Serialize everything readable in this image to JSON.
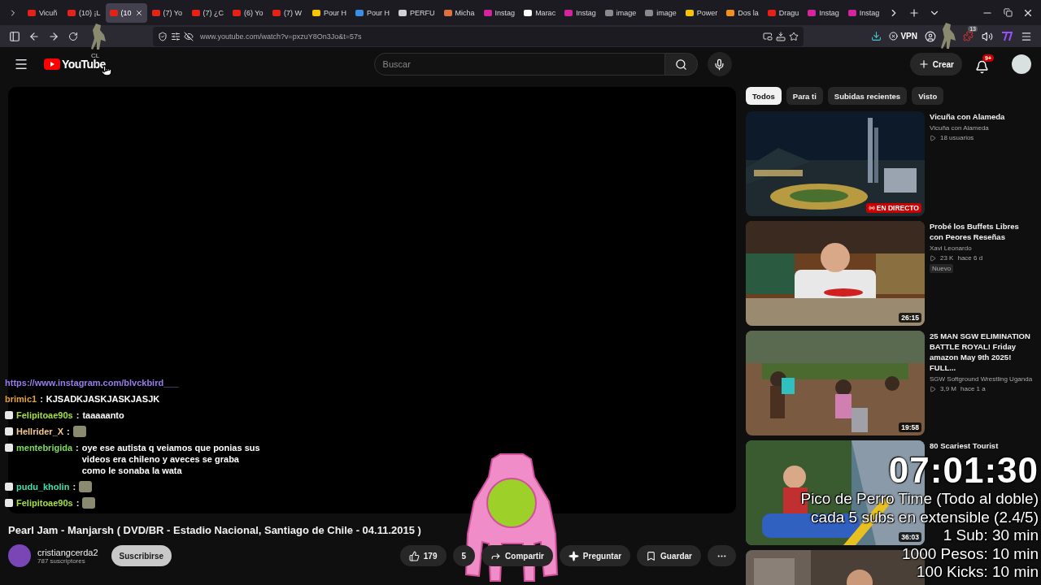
{
  "browser": {
    "tabs": [
      {
        "label": "Vicuñ",
        "color": "#e62117",
        "selected": false
      },
      {
        "label": "(10) ¡L",
        "color": "#e62117",
        "selected": false
      },
      {
        "label": "(10",
        "color": "#e62117",
        "selected": true
      },
      {
        "label": "(7) Yo",
        "color": "#e62117",
        "selected": false
      },
      {
        "label": "(7) ¿C",
        "color": "#e62117",
        "selected": false
      },
      {
        "label": "(6) Yo",
        "color": "#e62117",
        "selected": false
      },
      {
        "label": "(7) W",
        "color": "#e62117",
        "selected": false
      },
      {
        "label": "Pour H",
        "color": "#f5c400",
        "selected": false
      },
      {
        "label": "Pour H",
        "color": "#3b8ee8",
        "selected": false
      },
      {
        "label": "PERFU",
        "color": "#d0d0d0",
        "selected": false
      },
      {
        "label": "Micha",
        "color": "#e07040",
        "selected": false
      },
      {
        "label": "Instag",
        "color": "#d6249f",
        "selected": false
      },
      {
        "label": "Marac",
        "color": "#ffffff",
        "selected": false
      },
      {
        "label": "Instag",
        "color": "#d6249f",
        "selected": false
      },
      {
        "label": "image",
        "color": "#8a8a8a",
        "selected": false
      },
      {
        "label": "image",
        "color": "#8a8a8a",
        "selected": false
      },
      {
        "label": "Power",
        "color": "#f5c400",
        "selected": false
      },
      {
        "label": "Dos la",
        "color": "#f09020",
        "selected": false
      },
      {
        "label": "Dragu",
        "color": "#e62117",
        "selected": false
      },
      {
        "label": "Instag",
        "color": "#d6249f",
        "selected": false
      },
      {
        "label": "Instag",
        "color": "#d6249f",
        "selected": false
      }
    ],
    "url": "www.youtube.com/watch?v=pxzuY8On3Jo&t=57s",
    "vpn": "VPN",
    "extension_badge": "13",
    "sticker_label": "CL"
  },
  "header": {
    "logo": "YouTube",
    "search": {
      "placeholder": "Buscar"
    },
    "create": "Crear",
    "notifications": "9+"
  },
  "video": {
    "title": "Pearl Jam - Manjarsh ( DVD/BR - Estadio Nacional, Santiago de Chile - 04.11.2015 )",
    "channel": {
      "name": "cristiangcerda2",
      "subscribers": "787 suscriptores",
      "subscribe": "Suscribirse"
    },
    "likes": "179",
    "dislikes": "5",
    "actions": [
      {
        "kind": "share",
        "label": "Compartir"
      },
      {
        "kind": "ask",
        "label": "Preguntar"
      },
      {
        "kind": "save",
        "label": "Guardar"
      }
    ]
  },
  "chat": [
    {
      "kind": "link",
      "text": "https://www.instagram.com/blvckbird___"
    },
    {
      "kind": "text",
      "user": "brimic1",
      "sep": ":",
      "color": "#e8a23c",
      "badge": false,
      "text": "KJSADKJASKJASKJASJK"
    },
    {
      "kind": "text",
      "user": "Felipitoae90s",
      "sep": ":",
      "color": "#a6e23a",
      "badge": true,
      "text": "taaaaanto"
    },
    {
      "kind": "emote",
      "user": "Hellrider_X",
      "sep": ":",
      "color": "#f2c98a",
      "badge": true
    },
    {
      "kind": "text",
      "user": "mentebrigida",
      "sep": ":",
      "color": "#7ede5a",
      "badge": true,
      "text": "oye ese autista q veiamos que ponias sus videos era chileno y aveces se graba como le sonaba la wata"
    },
    {
      "kind": "emote",
      "user": "pudu_kholin",
      "sep": ":",
      "color": "#3ee0b0",
      "badge": true
    },
    {
      "kind": "emote",
      "user": "Felipitoae90s",
      "sep": ":",
      "color": "#a6e23a",
      "badge": true
    }
  ],
  "sidebar": {
    "chips": [
      {
        "label": "Todos",
        "selected": true
      },
      {
        "label": "Para ti",
        "selected": false
      },
      {
        "label": "Subidas recientes",
        "selected": false
      },
      {
        "label": "Visto",
        "selected": false
      }
    ],
    "videos": [
      {
        "title": "Vicuña con Alameda",
        "channel": "Vicuña con Alameda",
        "views": "18 usuarios",
        "live": "EN DIRECTO"
      },
      {
        "title": "Probé los Buffets Libres con Peores Reseñas",
        "channel": "Xavi Leonardo",
        "views": "23 K",
        "age": "hace 6 d",
        "badge": "Nuevo",
        "duration": "26:15"
      },
      {
        "title": "25 MAN SGW ELIMINATION BATTLE ROYAL! Friday amazon May 9th 2025! FULL...",
        "channel": "SGW Softground Wrestling Uganda",
        "views": "3,9 M",
        "age": "hace 1 a",
        "duration": "19:58"
      },
      {
        "title": "80 Scariest Tourist",
        "duration": "36:03"
      },
      {
        "kind": "picture"
      }
    ]
  },
  "timer": {
    "time": "07:01:30",
    "lines": [
      "Pico de Perro Time (Todo al doble)",
      "cada 5 subs en extensible (2.4/5)",
      "1 Sub: 30 min",
      "1000 Pesos: 10 min",
      "100 Kicks: 10 min"
    ]
  }
}
